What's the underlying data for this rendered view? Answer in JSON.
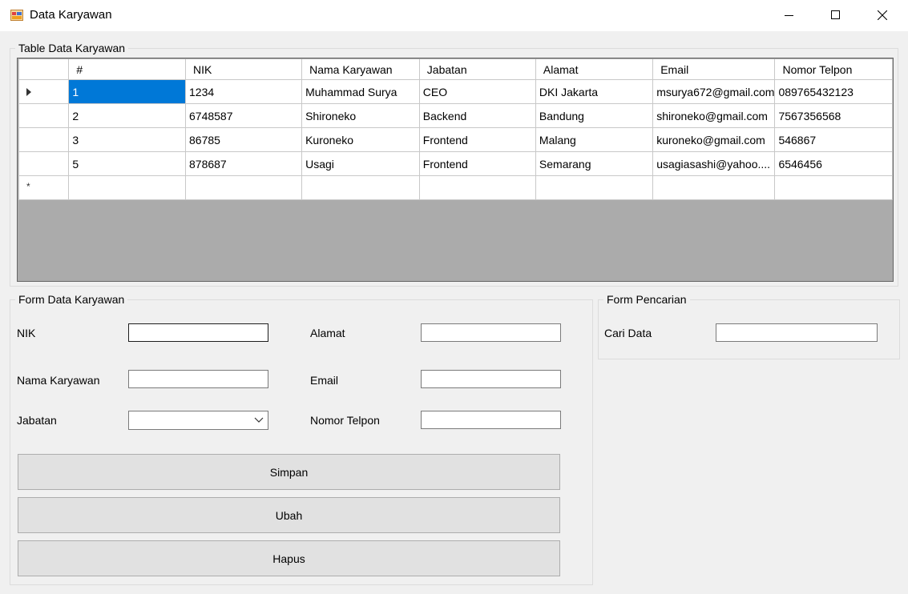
{
  "window": {
    "title": "Data Karyawan"
  },
  "table_group": {
    "title": "Table Data Karyawan",
    "columns": [
      "#",
      "NIK",
      "Nama Karyawan",
      "Jabatan",
      "Alamat",
      "Email",
      "Nomor Telpon"
    ],
    "rows": [
      [
        "1",
        "1234",
        "Muhammad Surya",
        "CEO",
        "DKI Jakarta",
        "msurya672@gmail.com",
        "089765432123"
      ],
      [
        "2",
        "6748587",
        "Shironeko",
        "Backend",
        "Bandung",
        "shironeko@gmail.com",
        "7567356568"
      ],
      [
        "3",
        "86785",
        "Kuroneko",
        "Frontend",
        "Malang",
        "kuroneko@gmail.com",
        "546867"
      ],
      [
        "5",
        "878687",
        "Usagi",
        "Frontend",
        "Semarang",
        "usagiasashi@yahoo....",
        "6546456"
      ]
    ],
    "new_row_marker": "*"
  },
  "form": {
    "title": "Form Data Karyawan",
    "nik_label": "NIK",
    "nik_value": "",
    "nama_label": "Nama Karyawan",
    "nama_value": "",
    "jabatan_label": "Jabatan",
    "jabatan_value": "",
    "alamat_label": "Alamat",
    "alamat_value": "",
    "email_label": "Email",
    "email_value": "",
    "telpon_label": "Nomor Telpon",
    "telpon_value": "",
    "simpan_label": "Simpan",
    "ubah_label": "Ubah",
    "hapus_label": "Hapus"
  },
  "search": {
    "title": "Form Pencarian",
    "label": "Cari Data",
    "value": ""
  }
}
